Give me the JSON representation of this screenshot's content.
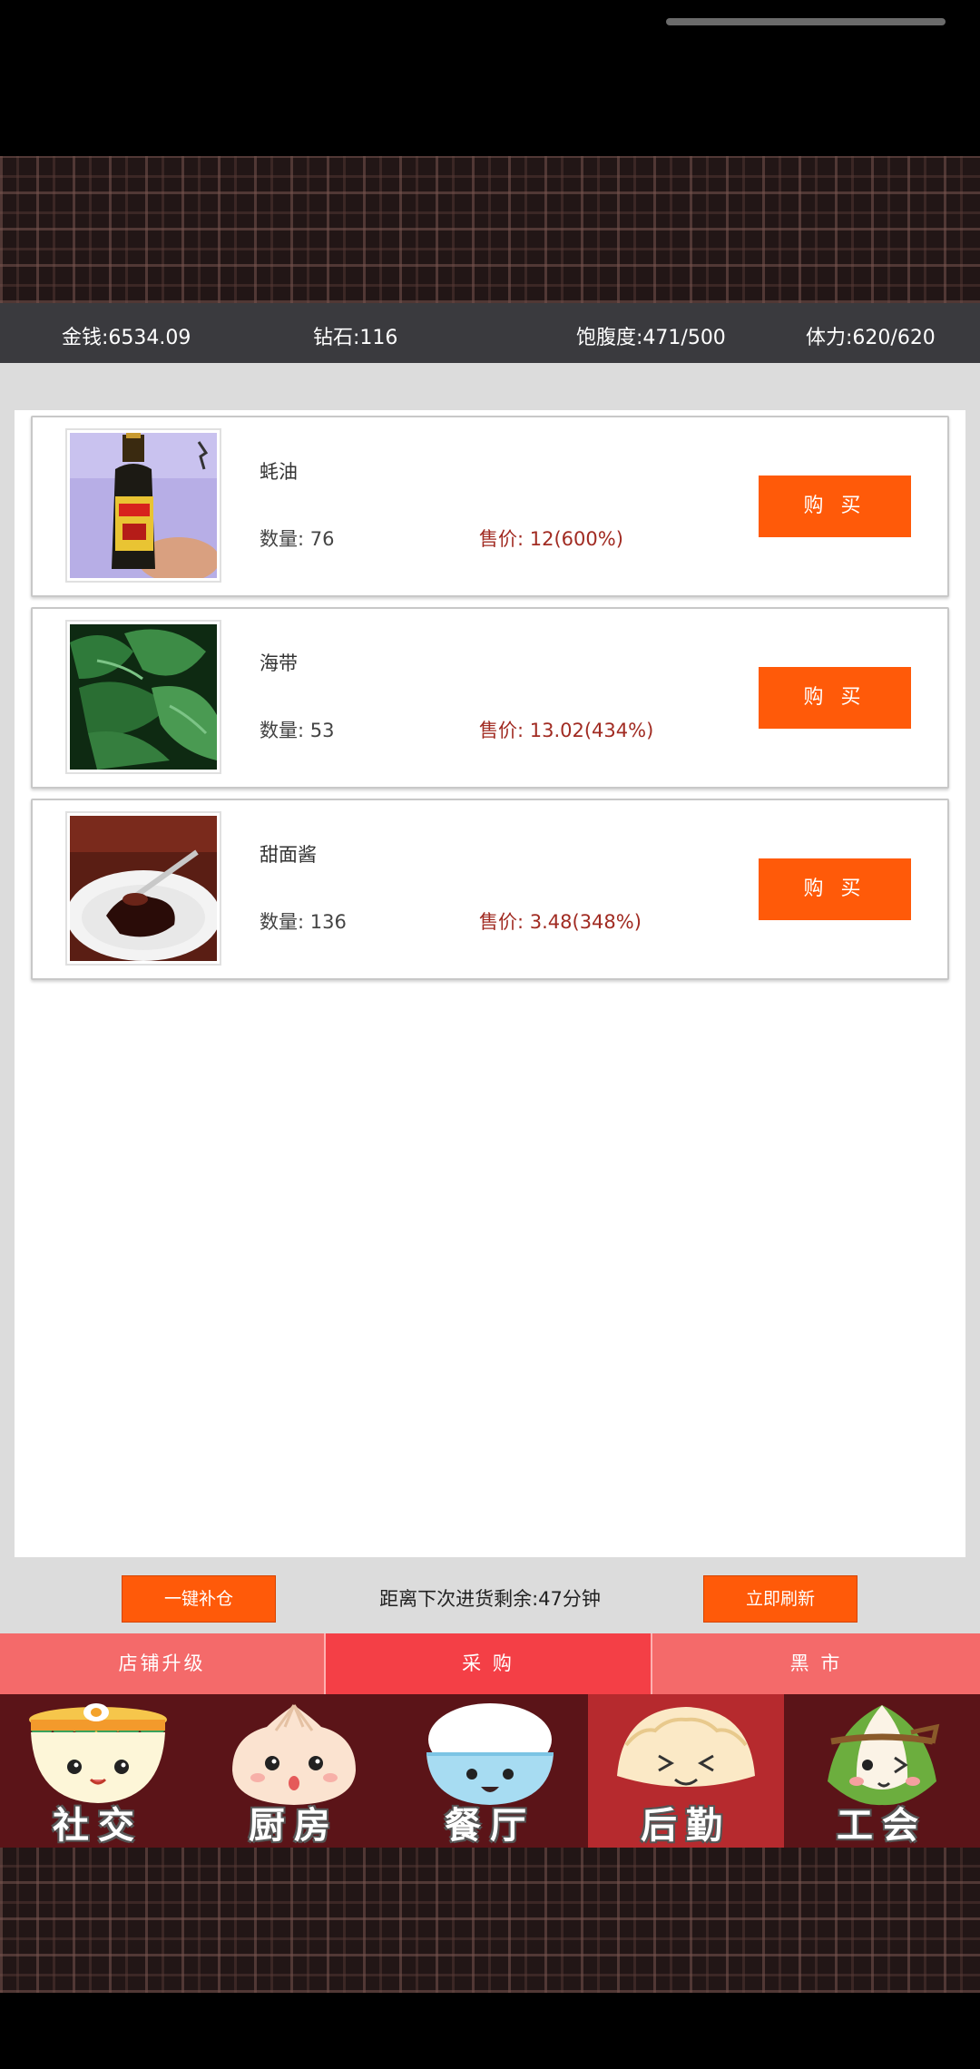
{
  "stats": {
    "money": "金钱:6534.09",
    "diamond": "钻石:116",
    "satiety": "饱腹度:471/500",
    "stamina": "体力:620/620"
  },
  "items": [
    {
      "name": "蚝油",
      "quantity": "数量: 76",
      "price": "售价: 12(600%)",
      "buy_label": "购 买",
      "image": "oyster-sauce-bottle"
    },
    {
      "name": "海带",
      "quantity": "数量: 53",
      "price": "售价: 13.02(434%)",
      "buy_label": "购 买",
      "image": "kelp"
    },
    {
      "name": "甜面酱",
      "quantity": "数量: 136",
      "price": "售价: 3.48(348%)",
      "buy_label": "购 买",
      "image": "sweet-bean-sauce"
    }
  ],
  "footer": {
    "restock_label": "一键补仓",
    "countdown": "距离下次进货剩余:47分钟",
    "refresh_label": "立即刷新"
  },
  "subtabs": [
    {
      "label": "店铺升级",
      "active": false
    },
    {
      "label": "采 购",
      "active": true
    },
    {
      "label": "黑 市",
      "active": false
    }
  ],
  "nav": [
    {
      "label": "社交",
      "icon": "ramen-bowl-icon",
      "active": false
    },
    {
      "label": "厨房",
      "icon": "bun-icon",
      "active": false
    },
    {
      "label": "餐厅",
      "icon": "rice-bowl-icon",
      "active": false
    },
    {
      "label": "后勤",
      "icon": "dumpling-icon",
      "active": true
    },
    {
      "label": "工会",
      "icon": "zongzi-icon",
      "active": false
    }
  ],
  "colors": {
    "accent": "#ff5a09",
    "price": "#a12b22",
    "tab_active": "#f43f46",
    "tab_inactive": "#f46a6a",
    "nav_bg": "#5b1418",
    "nav_active": "#b62a2e"
  }
}
